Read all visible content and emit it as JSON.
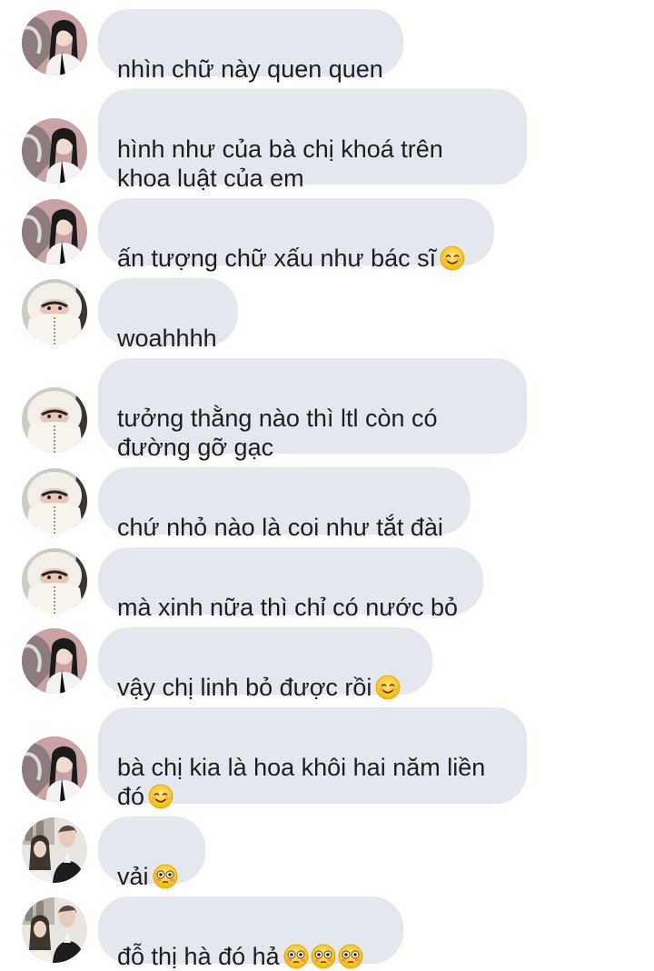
{
  "avatars": {
    "a": "avatar-girl-dark-hair",
    "b": "avatar-girl-white-hood",
    "c": "avatar-couple"
  },
  "messages": [
    {
      "avatar": "a",
      "text": "nhìn chữ này quen quen",
      "emoji": []
    },
    {
      "avatar": "a",
      "text": "hình như của bà chị khoá trên\nkhoa luật của em",
      "emoji": []
    },
    {
      "avatar": "a",
      "text": "ấn tượng chữ xấu như bác sĩ",
      "emoji": [
        "smiling-face"
      ]
    },
    {
      "avatar": "b",
      "text": "woahhhh",
      "emoji": []
    },
    {
      "avatar": "b",
      "text": "tưởng thằng nào thì ltl còn có\nđường gỡ gạc",
      "emoji": []
    },
    {
      "avatar": "b",
      "text": "chứ nhỏ nào là coi như tắt đài",
      "emoji": []
    },
    {
      "avatar": "b",
      "text": "mà xinh nữa thì chỉ có nước bỏ",
      "emoji": []
    },
    {
      "avatar": "a",
      "text": "vậy chị linh bỏ được rồi",
      "emoji": [
        "smiling-face"
      ]
    },
    {
      "avatar": "a",
      "text": "bà chị kia là hoa khôi hai năm liền\nđó",
      "emoji": [
        "smiling-face"
      ]
    },
    {
      "avatar": "c",
      "text": "vải",
      "emoji": [
        "flushed-face"
      ]
    },
    {
      "avatar": "c",
      "text": "đỗ thị hà đó hả",
      "emoji": [
        "flushed-face",
        "flushed-face",
        "flushed-face"
      ]
    }
  ],
  "colors": {
    "bubble": "#e4e7ed",
    "text": "#1c1e21",
    "background": "#ffffff"
  }
}
